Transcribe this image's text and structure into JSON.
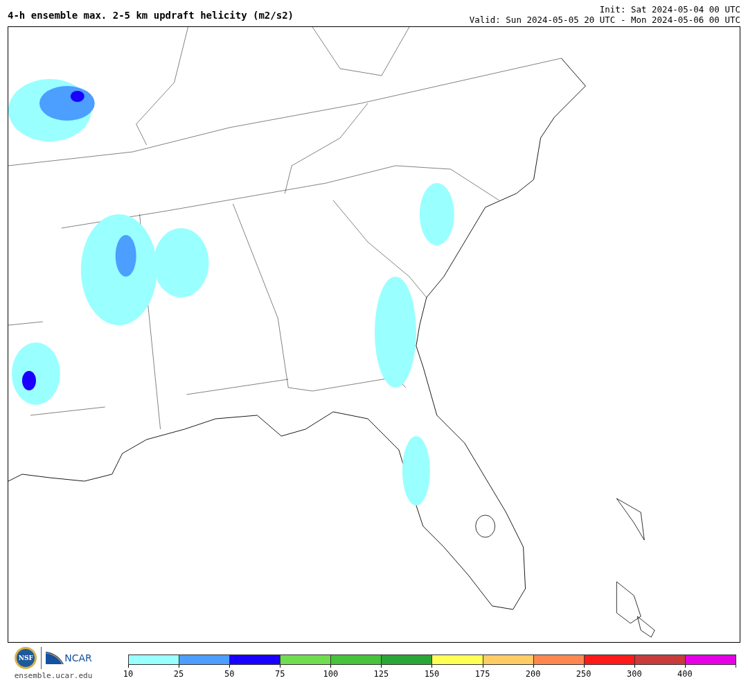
{
  "header": {
    "title": "4-h ensemble max. 2-5 km updraft helicity (m2/s2)",
    "init": "Init: Sat 2024-05-04 00 UTC",
    "valid": "Valid: Sun 2024-05-05 20 UTC - Mon 2024-05-06 00 UTC"
  },
  "footer": {
    "logos": [
      "NSF",
      "NCAR"
    ],
    "url": "ensemble.ucar.edu"
  },
  "legend": {
    "bins": [
      {
        "label": "10",
        "color": "#99ffff"
      },
      {
        "label": "25",
        "color": "#4c9eff"
      },
      {
        "label": "50",
        "color": "#1a00ff"
      },
      {
        "label": "75",
        "color": "#70dc50"
      },
      {
        "label": "100",
        "color": "#46c23c"
      },
      {
        "label": "125",
        "color": "#2aa636"
      },
      {
        "label": "150",
        "color": "#ffff55"
      },
      {
        "label": "175",
        "color": "#ffcc66"
      },
      {
        "label": "200",
        "color": "#ff8850"
      },
      {
        "label": "250",
        "color": "#ff1a1a"
      },
      {
        "label": "300",
        "color": "#c83c3c"
      },
      {
        "label": "400",
        "color": "#e600e6"
      }
    ]
  }
}
